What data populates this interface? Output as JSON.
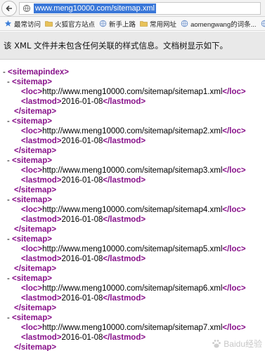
{
  "browser": {
    "url": "www.meng10000.com/sitemap.xml"
  },
  "bookmarks": [
    {
      "label": "最常访问",
      "icon": "star-folder-icon"
    },
    {
      "label": "火狐官方站点",
      "icon": "folder-icon"
    },
    {
      "label": "新手上路",
      "icon": "globe-icon"
    },
    {
      "label": "常用网址",
      "icon": "folder-icon"
    },
    {
      "label": "aomengwang的词条...",
      "icon": "globe-icon"
    },
    {
      "label": "Create your Goo",
      "icon": "globe-icon"
    }
  ],
  "notice": {
    "text": "该 XML 文件并未包含任何关联的样式信息。文档树显示如下。"
  },
  "xml": {
    "root_open": "<sitemapindex>",
    "sitemap_open": "<sitemap>",
    "sitemap_close": "</sitemap>",
    "loc_open": "<loc>",
    "loc_close": "</loc>",
    "lastmod_open": "<lastmod>",
    "lastmod_close": "</lastmod>",
    "toggle": "-",
    "entries": [
      {
        "loc": "http://www.meng10000.com/sitemap/sitemap1.xml",
        "lastmod": "2016-01-08"
      },
      {
        "loc": "http://www.meng10000.com/sitemap/sitemap2.xml",
        "lastmod": "2016-01-08"
      },
      {
        "loc": "http://www.meng10000.com/sitemap/sitemap3.xml",
        "lastmod": "2016-01-08"
      },
      {
        "loc": "http://www.meng10000.com/sitemap/sitemap4.xml",
        "lastmod": "2016-01-08"
      },
      {
        "loc": "http://www.meng10000.com/sitemap/sitemap5.xml",
        "lastmod": "2016-01-08"
      },
      {
        "loc": "http://www.meng10000.com/sitemap/sitemap6.xml",
        "lastmod": "2016-01-08"
      },
      {
        "loc": "http://www.meng10000.com/sitemap/sitemap7.xml",
        "lastmod": "2016-01-08"
      }
    ]
  },
  "watermark": {
    "text": "Baidu经验"
  }
}
